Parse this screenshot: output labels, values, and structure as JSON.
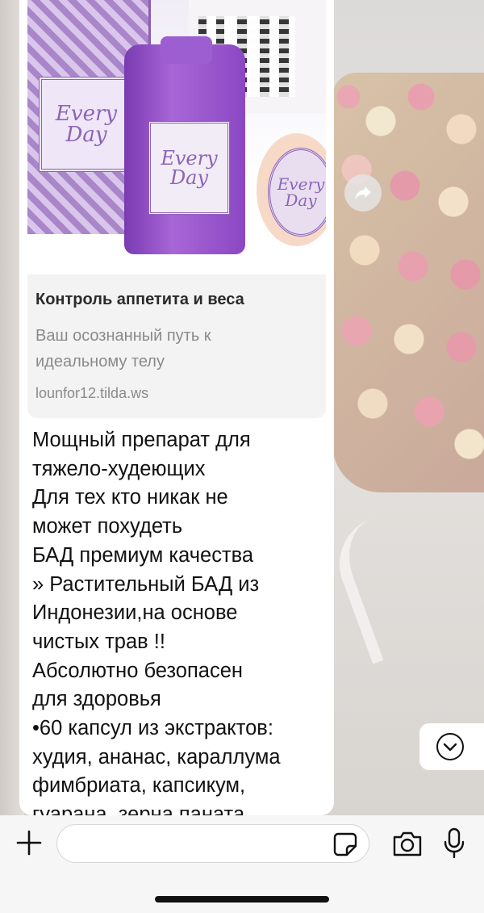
{
  "link_preview": {
    "title": "Контроль аппетита и веса",
    "description": "Ваш осознанный путь к идеальному телу",
    "url": "lounfor12.tilda.ws"
  },
  "product_image": {
    "brand_text": "Every Day"
  },
  "message": {
    "text": "Мощный препарат для\nтяжело-худеющих\nДля тех кто никак не\nможет похудеть\nБАД премиум качества\n» Растительный БАД из\nИндонезии,на основе\nчистых трав !!\nАбсолютно безопасен\nдля здоровья\n•60 капсул из экстрактов:\nхудия, ананас, караллума\nфимбриата, капсикум,\nгуарана, зерна паната"
  },
  "composer": {
    "placeholder": ""
  },
  "icons": {
    "forward": "forward-arrow-icon",
    "scroll_down": "chevron-down-circle-icon",
    "plus": "plus-icon",
    "sticker": "sticker-icon",
    "camera": "camera-icon",
    "mic": "microphone-icon"
  },
  "colors": {
    "bubble": "#ffffff",
    "link_card_bg": "#f3f3f3",
    "composer_bg": "#f6f6f6"
  }
}
